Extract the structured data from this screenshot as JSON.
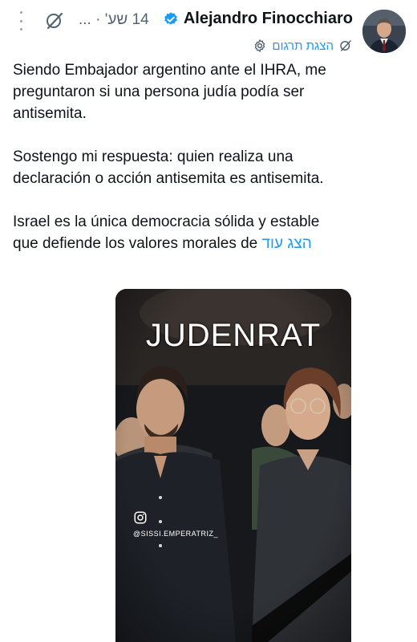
{
  "post": {
    "author_name": "Alejandro Finocchiaro",
    "time_label": "14 שע' · ...",
    "translate_label": "הצגת תרגום",
    "paragraphs": [
      "Siendo Embajador argentino ante el IHRA, me preguntaron si una persona judía podía ser antisemita.",
      "Sostengo mi respuesta: quien realiza una declaración o acción antisemita es antisemita."
    ],
    "last_paragraph": "Israel es la única democracia sólida y estable que defiende los valores morales de",
    "show_more_label": "הצג עוד"
  },
  "media": {
    "overlay_title": "JUDENRAT",
    "watermark_handle": "@SISSI.EMPERATRIZ_"
  },
  "icons": {
    "menu": "more-vertical-icon",
    "grok": "grok-icon",
    "verified": "verified-badge-icon",
    "translate_settings": "gear-icon",
    "translate_grok": "grok-icon",
    "watermark": "instagram-icon"
  },
  "colors": {
    "link": "#1d9bf0",
    "secondary_text": "#536471",
    "verified": "#1d9bf0"
  }
}
